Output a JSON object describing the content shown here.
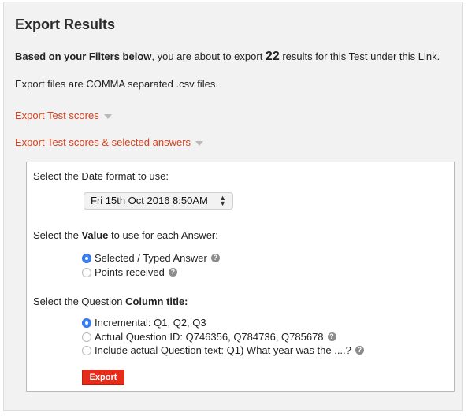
{
  "header": {
    "title": "Export Results"
  },
  "summary": {
    "lead": "Based on your Filters below",
    "text1": ", you are about to export ",
    "count": "22",
    "text2": " results for this Test under this Link."
  },
  "note": "Export files are COMMA separated .csv files.",
  "links": {
    "scores": "Export Test scores",
    "scores_answers": "Export Test scores & selected answers"
  },
  "options": {
    "date_label": "Select the Date format to use:",
    "date_value": "Fri 15th Oct 2016 8:50AM",
    "value_label_pre": "Select the ",
    "value_label_bold": "Value",
    "value_label_post": " to use for each Answer:",
    "value_options": [
      {
        "label": "Selected / Typed Answer",
        "checked": true
      },
      {
        "label": "Points received",
        "checked": false
      }
    ],
    "column_label_pre": "Select the Question ",
    "column_label_bold": "Column title:",
    "column_options": [
      {
        "label": "Incremental: Q1, Q2, Q3",
        "checked": true
      },
      {
        "label": "Actual Question ID: Q746356, Q784736, Q785678",
        "checked": false
      },
      {
        "label": "Include actual Question text: Q1) What year was the ....?",
        "checked": false
      }
    ],
    "export_button": "Export"
  },
  "icons": {
    "help": "help-icon",
    "caret": "caret-down-icon"
  },
  "colors": {
    "link": "#d5401d",
    "button": "#e52c1b",
    "radio_on": "#3b82f6"
  }
}
